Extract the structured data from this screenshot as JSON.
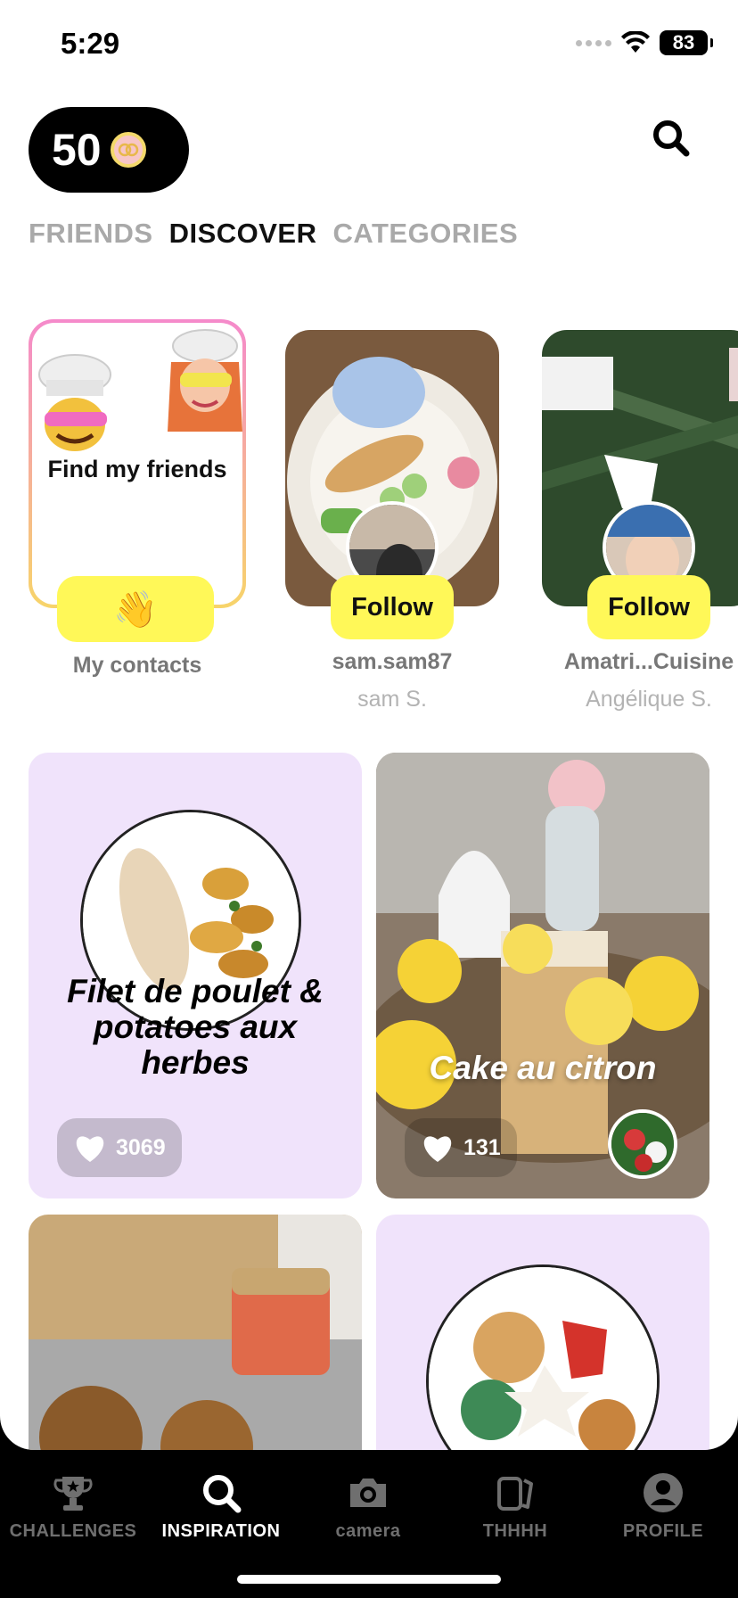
{
  "status": {
    "time": "5:29",
    "battery": "83"
  },
  "header": {
    "coins": "50"
  },
  "tabs": [
    {
      "label": "FRIENDS",
      "active": false
    },
    {
      "label": "DISCOVER",
      "active": true
    },
    {
      "label": "CATEGORIES",
      "active": false
    }
  ],
  "find_friends": {
    "title": "Find my friends",
    "button_emoji": "👋",
    "label": "My contacts"
  },
  "suggestions": [
    {
      "username": "sam.sam87",
      "name": "sam S.",
      "follow_label": "Follow"
    },
    {
      "username": "Amatri...Cuisine",
      "name": "Angélique S.",
      "follow_label": "Follow"
    }
  ],
  "posts": [
    {
      "title": "Filet de poulet & potatoes aux herbes",
      "likes": "3069"
    },
    {
      "title": "Cake au citron",
      "likes": "131"
    }
  ],
  "tabbar": [
    {
      "label": "CHALLENGES",
      "icon": "trophy-icon",
      "active": false
    },
    {
      "label": "INSPIRATION",
      "icon": "search-icon",
      "active": true
    },
    {
      "label": "camera",
      "icon": "camera-icon",
      "active": false
    },
    {
      "label": "THHHH",
      "icon": "cards-icon",
      "active": false
    },
    {
      "label": "PROFILE",
      "icon": "profile-icon",
      "active": false
    }
  ],
  "colors": {
    "accent": "#fff858",
    "card_lilac": "#f0e3fb",
    "tab_inactive": "#a9a9a9"
  }
}
